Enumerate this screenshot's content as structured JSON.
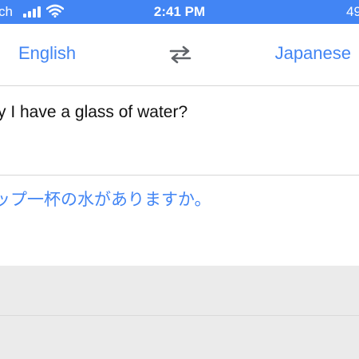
{
  "status_bar": {
    "carrier": "ch",
    "time": "2:41 PM",
    "battery": "49"
  },
  "languages": {
    "source": "English",
    "target": "Japanese",
    "swap_icon": "swap-arrows-icon"
  },
  "input": {
    "text": "y I have a glass of water?"
  },
  "output": {
    "text": "ップ一杯の水がありますか。"
  },
  "colors": {
    "accent": "#4285f4",
    "background": "#ebebeb",
    "divider": "#d6d6d6"
  }
}
